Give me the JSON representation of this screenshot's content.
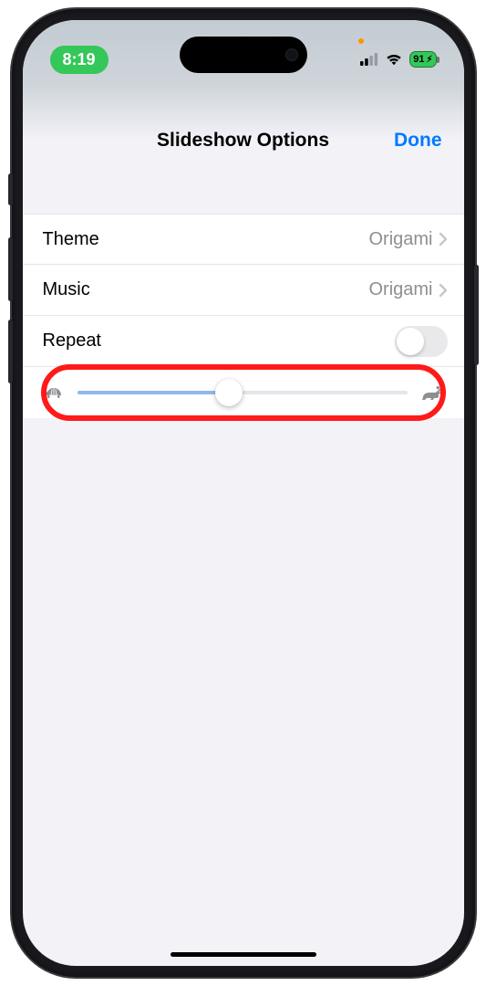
{
  "status": {
    "time": "8:19",
    "battery_text": "91",
    "battery_charging": true
  },
  "nav": {
    "title": "Slideshow Options",
    "done": "Done"
  },
  "rows": {
    "theme": {
      "label": "Theme",
      "value": "Origami"
    },
    "music": {
      "label": "Music",
      "value": "Origami"
    },
    "repeat": {
      "label": "Repeat",
      "on": false
    }
  },
  "slider": {
    "min_icon": "turtle-icon",
    "max_icon": "rabbit-icon",
    "percent": 46
  }
}
